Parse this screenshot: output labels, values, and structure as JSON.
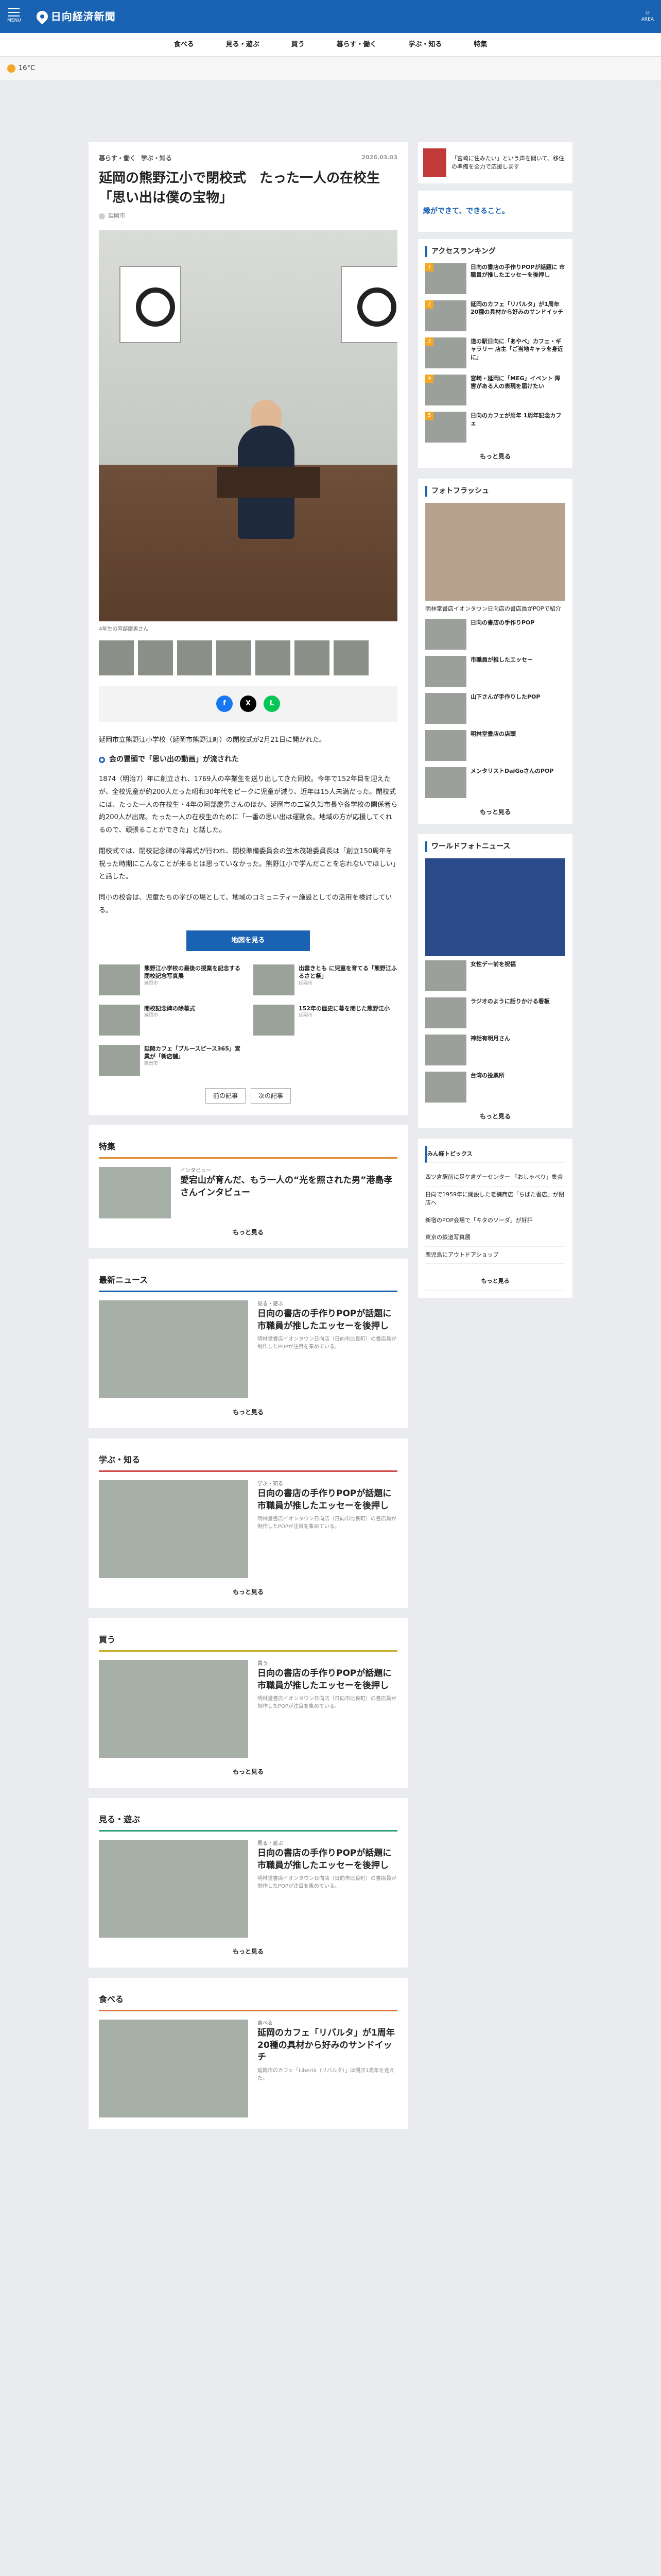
{
  "header": {
    "menu": "MENU",
    "logo": "日向経済新聞",
    "logo_sub": "HYUGA",
    "area": "AREA"
  },
  "nav": [
    "食べる",
    "見る・遊ぶ",
    "買う",
    "暮らす・働く",
    "学ぶ・知る",
    "特集"
  ],
  "weather": {
    "temp": "16°C"
  },
  "article": {
    "tags": [
      "暮らす・働く",
      "学ぶ・知る"
    ],
    "date": "2026.03.03",
    "title": "延岡の熊野江小で閉校式　たった一人の在校生「思い出は僕の宝物」",
    "author": "延岡市",
    "caption": "4年生の阿部慶男さん",
    "lead": "延岡市立熊野江小学校（延岡市熊野江町）の閉校式が2月21日に開かれた。",
    "subhead": "会の冒頭で「思い出の動画」が流された",
    "body": [
      "1874（明治7）年に創立され、1769人の卒業生を送り出してきた同校。今年で152年目を迎えたが、全校児童が約200人だった昭和30年代をピークに児童が減り、近年は15人未満だった。閉校式には、たった一人の在校生・4年の阿部慶男さんのほか、延岡市の二宮久知市長や各学校の関係者ら約200人が出席。たった一人の在校生のために「一番の思い出は運動会。地域の方が応援してくれるので、頑張ることができた」と話した。",
      "閉校式では、閉校記念碑の除幕式が行われ、閉校準備委員会の笠木茂雄委員長は「創立150周年を祝った時期にこんなことが来るとは思っていなかった。熊野江小で学んだことを忘れないでほしい」と話した。",
      "同小の校舎は、児童たちの学びの場として、地域のコミュニティー施設としての活用を検討している。"
    ],
    "button": "地図を見る",
    "related": [
      {
        "t": "熊野江小学校の最後の授業を記念する閉校記念写真展",
        "c": "延岡市"
      },
      {
        "t": "出雲きとも に児童を育てる「熊野江ふるさと祭」",
        "c": "延岡市"
      },
      {
        "t": "閉校記念碑の除幕式",
        "c": "延岡市"
      },
      {
        "t": "152年の歴史に幕を閉じた熊野江小",
        "c": "延岡市"
      },
      {
        "t": "延岡カフェ「ブルースピース365」営業が「新店舗」",
        "c": "延岡市"
      }
    ],
    "prev": "前の記事",
    "next": "次の記事"
  },
  "sections": [
    {
      "h": "特集",
      "color": "#e08a2e",
      "t": "愛宕山が育んだ、もう一人の“光を照された男”港島孝さんインタビュー",
      "cat": "インタビュー",
      "d": "",
      "more": "もっと見る"
    },
    {
      "h": "最新ニュース",
      "color": "#1a63b3",
      "t": "日向の書店の手作りPOPが話題に 市職員が推したエッセーを後押し",
      "cat": "見る・遊ぶ",
      "d": "明林堂書店イオンタウン日向店（日向市比良町）の書店員が制作したPOPが注目を集めている。",
      "more": "もっと見る"
    },
    {
      "h": "学ぶ・知る",
      "color": "#d14b4b",
      "t": "日向の書店の手作りPOPが話題に 市職員が推したエッセーを後押し",
      "cat": "学ぶ・知る",
      "d": "明林堂書店イオンタウン日向店（日向市比良町）の書店員が制作したPOPが注目を集めている。",
      "more": "もっと見る"
    },
    {
      "h": "買う",
      "color": "#c9b02e",
      "t": "日向の書店の手作りPOPが話題に 市職員が推したエッセーを後押し",
      "cat": "買う",
      "d": "明林堂書店イオンタウン日向店（日向市比良町）の書店員が制作したPOPが注目を集めている。",
      "more": "もっと見る"
    },
    {
      "h": "見る・遊ぶ",
      "color": "#2e9e7a",
      "t": "日向の書店の手作りPOPが話題に 市職員が推したエッセーを後押し",
      "cat": "見る・遊ぶ",
      "d": "明林堂書店イオンタウン日向店（日向市比良町）の書店員が制作したPOPが注目を集めている。",
      "more": "もっと見る"
    },
    {
      "h": "食べる",
      "color": "#e0703a",
      "t": "延岡のカフェ「リバルタ」が1周年 20種の具材から好みのサンドイッチ",
      "cat": "食べる",
      "d": "延岡市のカフェ「Libertà（リバルタ）」は開店1周年を迎えた。",
      "more": "もっと見る"
    }
  ],
  "side": {
    "ad1": "「宮崎に住みたい」という声を聞いて、移住の準備を全力で応援します",
    "ad2": "縁ができて、できること。",
    "ranking_h": "アクセスランキング",
    "ranking": [
      "日向の書店の手作りPOPが話題に 市職員が推したエッセーを後押し",
      "延岡のカフェ「リバルタ」が1周年 20種の具材から好みのサンドイッチ",
      "道の駅日向に「あやべ」カフェ・ギャラリー 店主「ご当地キャラを身近に」",
      "宮崎・延岡に「MEG」イベント 障害がある人の表現を届けたい",
      "日向のカフェが周年 1周年記念カフェ"
    ],
    "ranking_more": "もっと見る",
    "photo_h": "フォトフラッシュ",
    "photo_cap": "明林堂書店イオンタウン日向店の書店員がPOPで紹介",
    "photos": [
      "日向の書店の手作りPOP",
      "市職員が推したエッセー",
      "山下さんが手作りしたPOP",
      "明林堂書店の店頭",
      "メンタリストDaiGoさんのPOP"
    ],
    "photo_more": "もっと見る",
    "world_h": "ワールドフォトニュース",
    "world": [
      "女性デー前を祝福",
      "ラジオのように話りかける看板",
      "神話有明月さん",
      "台湾の投票所"
    ],
    "world_more": "もっと見る",
    "topics_h": "みん経トピックス",
    "topics": [
      "四ツ倉駅前に足ケ倉ゲーセンター 「おしゃべり」集合",
      "日向で1959年に開設した老舗商店「ちばた書店」が閉店へ",
      "新宿のPOP会場で「キタのソーダ」が好評",
      "東京の鉄道写真展",
      "鹿児島にアウトドアショップ"
    ],
    "topics_more": "もっと見る"
  }
}
